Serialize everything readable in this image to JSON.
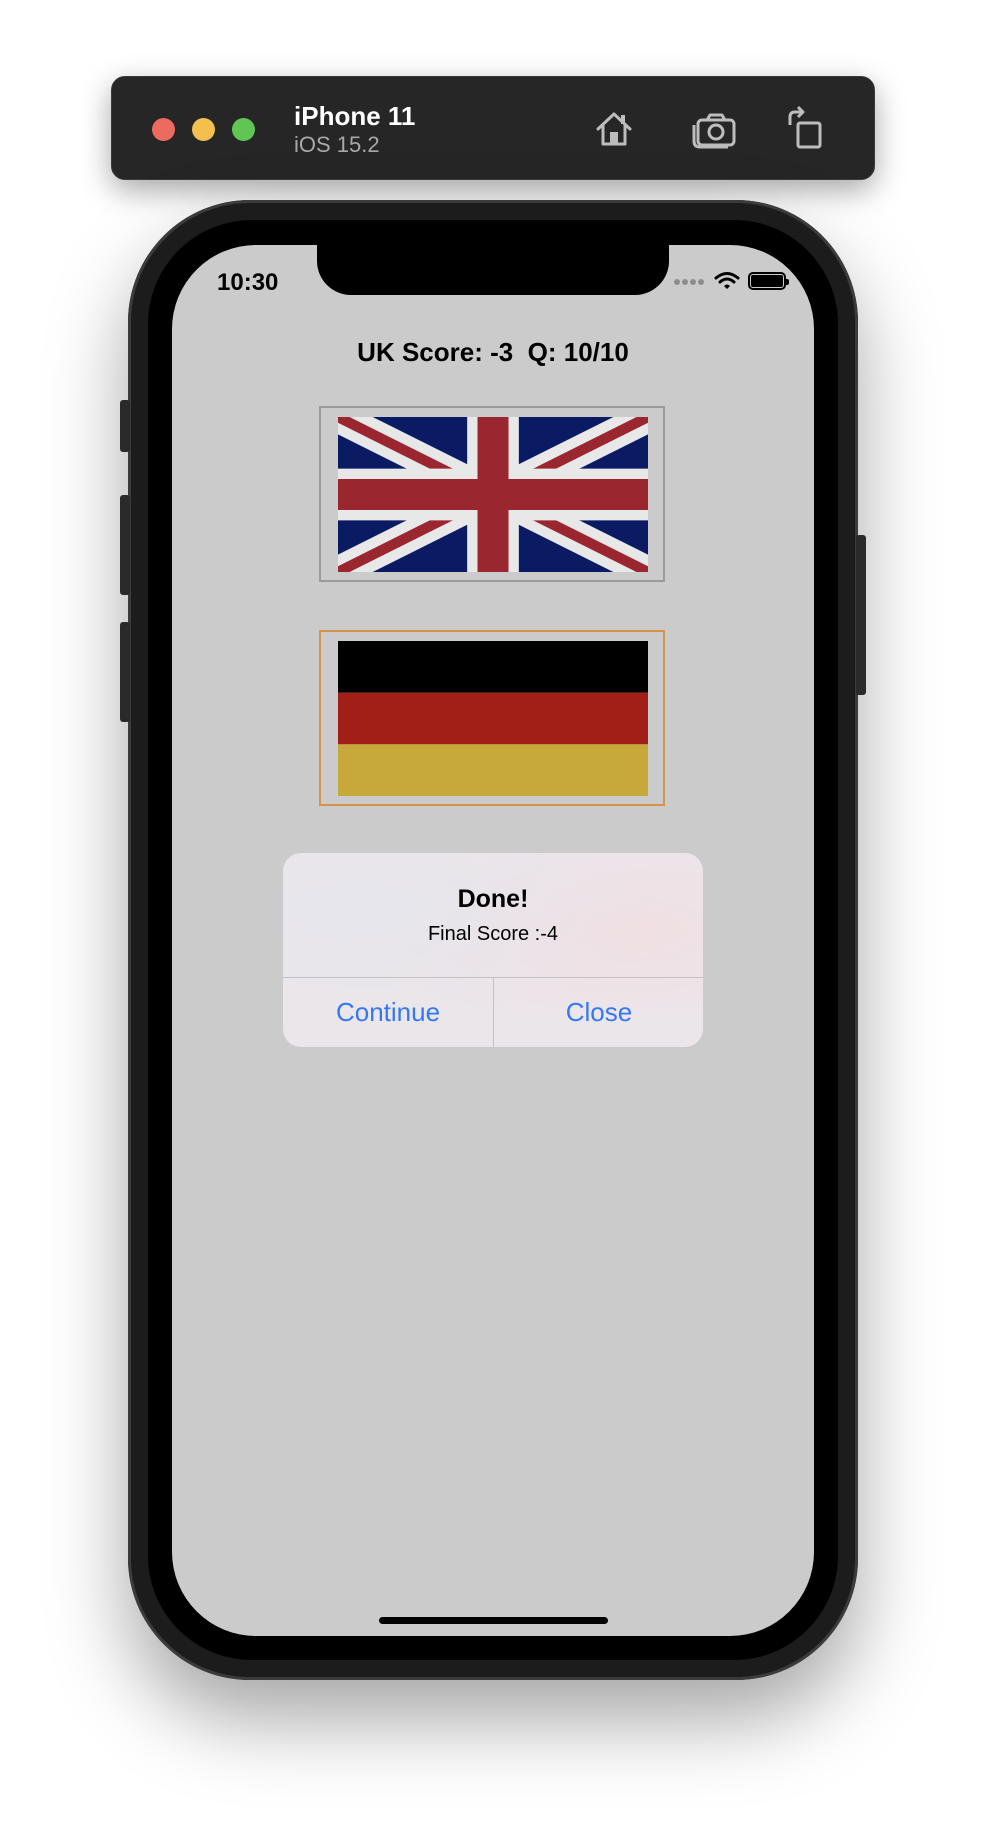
{
  "simulator": {
    "device_name": "iPhone 11",
    "os_version": "iOS 15.2",
    "icons": [
      "home-icon",
      "screenshot-icon",
      "rotate-icon"
    ]
  },
  "status_bar": {
    "time": "10:30",
    "icons": [
      "signal-icon",
      "wifi-icon",
      "battery-icon"
    ]
  },
  "game": {
    "score_line": "UK Score: -3  Q: 10/10",
    "flags": [
      {
        "country": "UK",
        "icon": "uk-flag-icon"
      },
      {
        "country": "Germany",
        "icon": "germany-flag-icon"
      },
      {
        "country": "",
        "icon": "flag-icon"
      }
    ]
  },
  "alert": {
    "title": "Done!",
    "message": "Final Score :-4",
    "buttons": {
      "continue": "Continue",
      "close": "Close"
    }
  },
  "colors": {
    "screen_bg": "#cbcbcb",
    "alert_button": "#3478f6",
    "uk_blue": "#0a1a63",
    "uk_red": "#9a2630",
    "de_black": "#000000",
    "de_red": "#a21f18",
    "de_gold": "#c7a83b"
  }
}
